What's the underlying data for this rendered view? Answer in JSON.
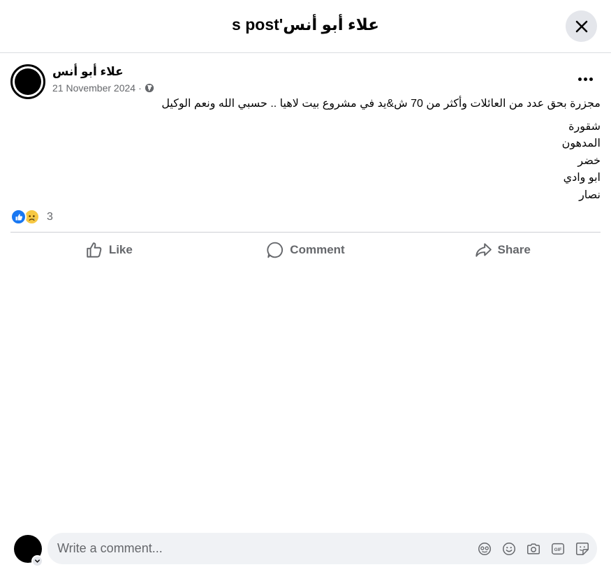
{
  "header": {
    "title": "علاء أبو أنس's post"
  },
  "post": {
    "author": "علاء أبو أنس",
    "date": "21 November 2024",
    "separator": "·",
    "text_lines": [
      "مجزرة بحق عدد من العائلات وأكثر من 70 ش&يد في مشروع بيت لاهيا  .. حسبي الله ونعم الوكيل",
      "شقورة",
      "المدهون",
      "خضر",
      "ابو وادي",
      "نصار"
    ],
    "reaction_count": "3"
  },
  "actions": {
    "like": "Like",
    "comment": "Comment",
    "share": "Share"
  },
  "composer": {
    "placeholder": "Write a comment..."
  },
  "icons": {
    "close": "close-icon",
    "more": "more-icon",
    "globe": "globe-icon",
    "like_reaction": "like-reaction-icon",
    "sad_reaction": "sad-reaction-icon",
    "like": "thumbs-up-icon",
    "comment": "comment-bubble-icon",
    "share": "share-arrow-icon",
    "avatar_sticker": "avatar-sticker-icon",
    "emoji": "emoji-icon",
    "camera": "camera-icon",
    "gif": "gif-icon",
    "sticker": "sticker-icon"
  },
  "colors": {
    "brand_blue": "#1877f2",
    "secondary_text": "#65676b",
    "input_bg": "#f0f2f5"
  }
}
